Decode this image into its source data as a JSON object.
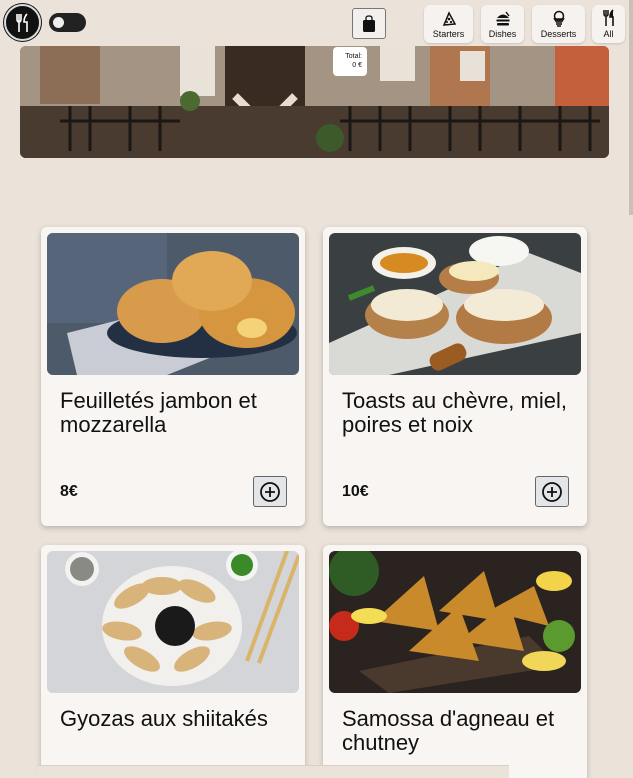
{
  "header": {
    "cart_total_label": "Total:",
    "cart_total_value": "0 €"
  },
  "categories": [
    {
      "label": "Starters",
      "icon": "pizza-slice-icon"
    },
    {
      "label": "Dishes",
      "icon": "burger-icon"
    },
    {
      "label": "Desserts",
      "icon": "ice-cream-icon"
    },
    {
      "label": "All",
      "icon": "fork-knife-icon"
    }
  ],
  "products": [
    {
      "name": "Feuilletés jambon et mozzarella",
      "price": "8€"
    },
    {
      "name": "Toasts au chèvre, miel, poires et noix",
      "price": "10€"
    },
    {
      "name": "Gyozas aux shiitakés",
      "price": ""
    },
    {
      "name": "Samossa d'agneau et chutney",
      "price": ""
    }
  ]
}
